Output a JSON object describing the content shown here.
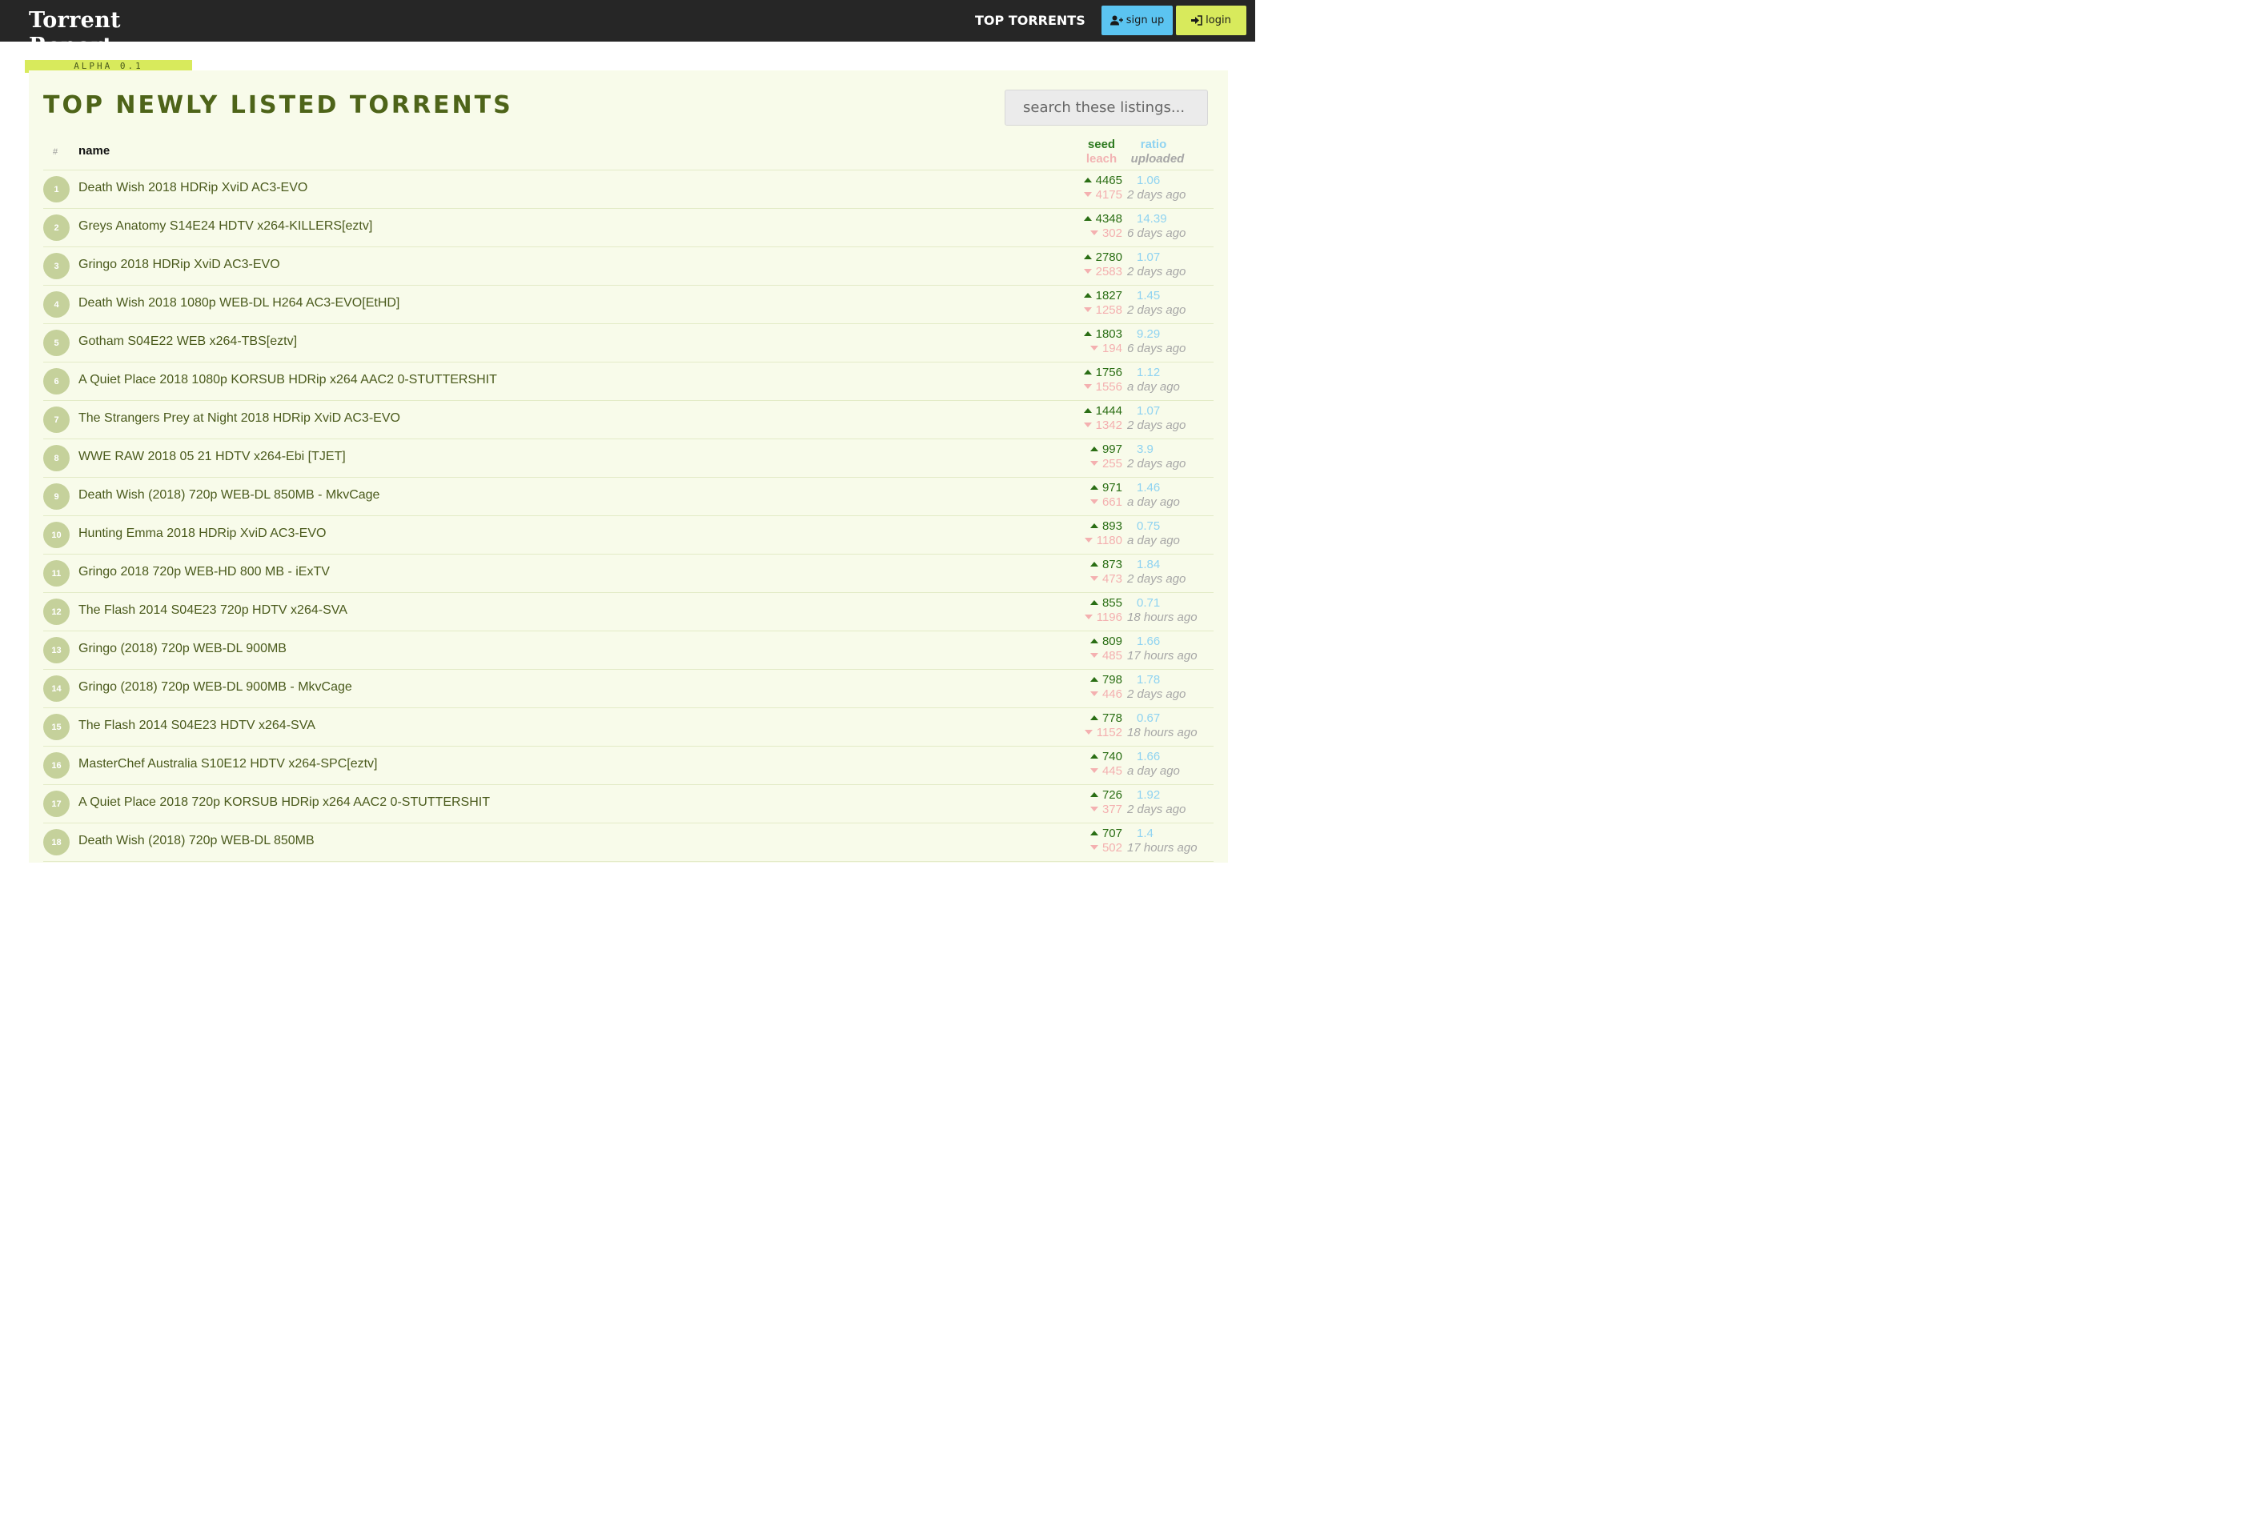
{
  "brand": {
    "title": "Torrent Report",
    "badge": "ALPHA 0.1"
  },
  "nav": {
    "top_torrents": "TOP TORRENTS",
    "signup": "sign up",
    "login": "login"
  },
  "icons": {
    "signup": "user-plus-icon",
    "login": "sign-in-icon"
  },
  "colors": {
    "topbar": "#262626",
    "accent_green": "#d8ea5c",
    "accent_blue": "#5bc4f1",
    "panel": "#f8fbea"
  },
  "page": {
    "title": "TOP NEWLY LISTED TORRENTS"
  },
  "search": {
    "placeholder": "search these listings..."
  },
  "table": {
    "headers": {
      "num": "#",
      "name": "name",
      "seed": "seed",
      "leach": "leach",
      "ratio": "ratio",
      "uploaded": "uploaded"
    },
    "rows": [
      {
        "rank": "1",
        "name": "Death Wish 2018 HDRip XviD AC3-EVO",
        "seed": "4465",
        "leech": "4175",
        "ratio": "1.06",
        "uploaded": "2 days ago"
      },
      {
        "rank": "2",
        "name": "Greys Anatomy S14E24 HDTV x264-KILLERS[eztv]",
        "seed": "4348",
        "leech": "302",
        "ratio": "14.39",
        "uploaded": "6 days ago"
      },
      {
        "rank": "3",
        "name": "Gringo 2018 HDRip XviD AC3-EVO",
        "seed": "2780",
        "leech": "2583",
        "ratio": "1.07",
        "uploaded": "2 days ago"
      },
      {
        "rank": "4",
        "name": "Death Wish 2018 1080p WEB-DL H264 AC3-EVO[EtHD]",
        "seed": "1827",
        "leech": "1258",
        "ratio": "1.45",
        "uploaded": "2 days ago"
      },
      {
        "rank": "5",
        "name": "Gotham S04E22 WEB x264-TBS[eztv]",
        "seed": "1803",
        "leech": "194",
        "ratio": "9.29",
        "uploaded": "6 days ago"
      },
      {
        "rank": "6",
        "name": "A Quiet Place 2018 1080p KORSUB HDRip x264 AAC2 0-STUTTERSHIT",
        "seed": "1756",
        "leech": "1556",
        "ratio": "1.12",
        "uploaded": "a day ago"
      },
      {
        "rank": "7",
        "name": "The Strangers Prey at Night 2018 HDRip XviD AC3-EVO",
        "seed": "1444",
        "leech": "1342",
        "ratio": "1.07",
        "uploaded": "2 days ago"
      },
      {
        "rank": "8",
        "name": "WWE RAW 2018 05 21 HDTV x264-Ebi [TJET]",
        "seed": "997",
        "leech": "255",
        "ratio": "3.9",
        "uploaded": "2 days ago"
      },
      {
        "rank": "9",
        "name": "Death Wish (2018) 720p WEB-DL 850MB - MkvCage",
        "seed": "971",
        "leech": "661",
        "ratio": "1.46",
        "uploaded": "a day ago"
      },
      {
        "rank": "10",
        "name": "Hunting Emma 2018 HDRip XviD AC3-EVO",
        "seed": "893",
        "leech": "1180",
        "ratio": "0.75",
        "uploaded": "a day ago"
      },
      {
        "rank": "11",
        "name": "Gringo 2018 720p WEB-HD 800 MB - iExTV",
        "seed": "873",
        "leech": "473",
        "ratio": "1.84",
        "uploaded": "2 days ago"
      },
      {
        "rank": "12",
        "name": "The Flash 2014 S04E23 720p HDTV x264-SVA",
        "seed": "855",
        "leech": "1196",
        "ratio": "0.71",
        "uploaded": "18 hours ago"
      },
      {
        "rank": "13",
        "name": "Gringo (2018) 720p WEB-DL 900MB",
        "seed": "809",
        "leech": "485",
        "ratio": "1.66",
        "uploaded": "17 hours ago"
      },
      {
        "rank": "14",
        "name": "Gringo (2018) 720p WEB-DL 900MB - MkvCage",
        "seed": "798",
        "leech": "446",
        "ratio": "1.78",
        "uploaded": "2 days ago"
      },
      {
        "rank": "15",
        "name": "The Flash 2014 S04E23 HDTV x264-SVA",
        "seed": "778",
        "leech": "1152",
        "ratio": "0.67",
        "uploaded": "18 hours ago"
      },
      {
        "rank": "16",
        "name": "MasterChef Australia S10E12 HDTV x264-SPC[eztv]",
        "seed": "740",
        "leech": "445",
        "ratio": "1.66",
        "uploaded": "a day ago"
      },
      {
        "rank": "17",
        "name": "A Quiet Place 2018 720p KORSUB HDRip x264 AAC2 0-STUTTERSHIT",
        "seed": "726",
        "leech": "377",
        "ratio": "1.92",
        "uploaded": "2 days ago"
      },
      {
        "rank": "18",
        "name": "Death Wish (2018) 720p WEB-DL 850MB",
        "seed": "707",
        "leech": "502",
        "ratio": "1.4",
        "uploaded": "17 hours ago"
      }
    ]
  }
}
